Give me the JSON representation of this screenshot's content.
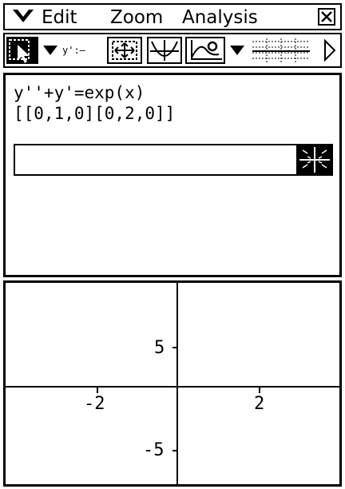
{
  "menu": {
    "edit": "Edit",
    "zoom": "Zoom",
    "analysis": "Analysis"
  },
  "toolbar": {
    "ytext": "y':—"
  },
  "editor": {
    "equation": "y''+y'=exp(x)",
    "initial_conditions": "[[0,1,0][0,2,0]]",
    "input_value": ""
  },
  "graph": {
    "x_ticks": [
      "-2",
      "2"
    ],
    "y_ticks": [
      "5",
      "-5"
    ]
  }
}
